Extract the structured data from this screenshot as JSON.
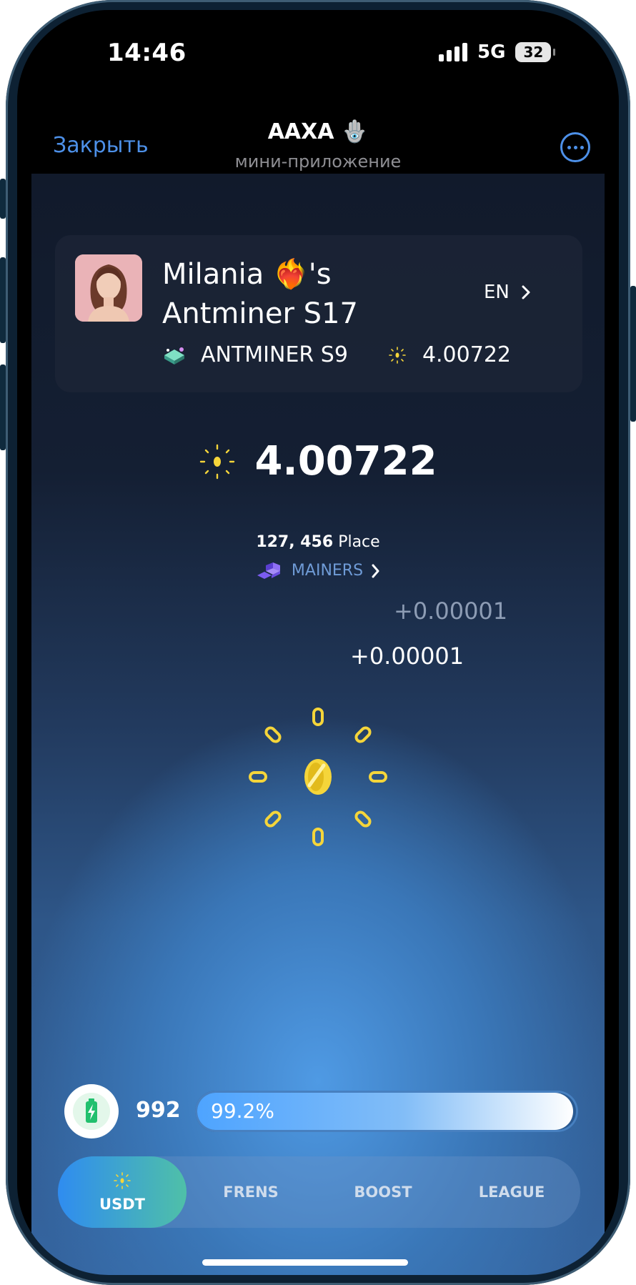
{
  "status_bar": {
    "time": "14:46",
    "network": "5G",
    "battery": "32"
  },
  "telegram_header": {
    "close_label": "Закрыть",
    "title": "AAXA 🪬",
    "subtitle": "мини-приложение"
  },
  "profile": {
    "name": "Milania ❤️‍🔥's Antminer S17",
    "language": "EN",
    "miner_model": "ANTMINER S9",
    "mini_balance": "4.00722"
  },
  "balance": {
    "value": "4.00722"
  },
  "rank": {
    "number": "127, 456",
    "label": "Place"
  },
  "mainers_link": {
    "label": "MAINERS"
  },
  "floating_gains": [
    "+0.00001",
    "+0.00001"
  ],
  "energy": {
    "value": "992",
    "percent_label": "99.2%",
    "fraction": 0.992
  },
  "tabs": [
    {
      "label": "USDT",
      "active": true
    },
    {
      "label": "FRENS",
      "active": false
    },
    {
      "label": "BOOST",
      "active": false
    },
    {
      "label": "LEAGUE",
      "active": false
    }
  ],
  "colors": {
    "accent_blue": "#4d90e8",
    "coin_yellow": "#f5d53a",
    "energy_green": "#22c06e",
    "tab_active_start": "#2f8cf0",
    "tab_active_end": "#4fc0a8"
  },
  "icons": {
    "more": "more-icon",
    "chevron": "chevron-right-icon",
    "coin": "coin-icon",
    "battery": "battery-charge-icon",
    "miner": "miner-device-icon",
    "mainers": "buildings-icon"
  }
}
